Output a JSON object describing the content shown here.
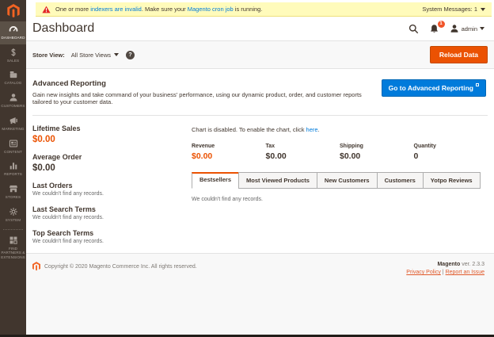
{
  "message_bar": {
    "prefix": "One or more ",
    "indexers_link": "indexers are invalid",
    "middle": ". Make sure your ",
    "cron_link": "Magento cron job",
    "suffix": " is running.",
    "system_messages_label": "System Messages: 1"
  },
  "header": {
    "title": "Dashboard",
    "notification_count": "1",
    "user_name": "admin"
  },
  "toolbar": {
    "store_view_label": "Store View:",
    "store_view_value": "All Store Views",
    "help_glyph": "?",
    "reload_button": "Reload Data"
  },
  "sidebar": {
    "items": [
      {
        "label": "DASHBOARD",
        "icon": "speedometer-icon",
        "active": true
      },
      {
        "label": "SALES",
        "icon": "dollar-icon"
      },
      {
        "label": "CATALOG",
        "icon": "box-icon"
      },
      {
        "label": "CUSTOMERS",
        "icon": "person-icon"
      },
      {
        "label": "MARKETING",
        "icon": "megaphone-icon"
      },
      {
        "label": "CONTENT",
        "icon": "page-icon"
      },
      {
        "label": "REPORTS",
        "icon": "bar-chart-icon"
      },
      {
        "label": "STORES",
        "icon": "storefront-icon"
      },
      {
        "label": "SYSTEM",
        "icon": "gear-icon"
      },
      {
        "label": "FIND PARTNERS & EXTENSIONS",
        "icon": "extensions-icon"
      }
    ]
  },
  "advanced_reporting": {
    "title": "Advanced Reporting",
    "description": "Gain new insights and take command of your business' performance, using our dynamic product, order, and customer reports tailored to your customer data.",
    "button": "Go to Advanced Reporting"
  },
  "metrics": [
    {
      "label": "Lifetime Sales",
      "value": "$0.00"
    },
    {
      "label": "Average Order",
      "value": "$0.00"
    },
    {
      "label": "Last Orders",
      "note": "We couldn't find any records."
    },
    {
      "label": "Last Search Terms",
      "note": "We couldn't find any records."
    },
    {
      "label": "Top Search Terms",
      "note": "We couldn't find any records."
    }
  ],
  "chart": {
    "disabled_prefix": "Chart is disabled. To enable the chart, click ",
    "enable_link": "here",
    "suffix": "."
  },
  "stats": [
    {
      "label": "Revenue",
      "value": "$0.00"
    },
    {
      "label": "Tax",
      "value": "$0.00"
    },
    {
      "label": "Shipping",
      "value": "$0.00"
    },
    {
      "label": "Quantity",
      "value": "0"
    }
  ],
  "tabs": {
    "items": [
      {
        "label": "Bestsellers",
        "active": true
      },
      {
        "label": "Most Viewed Products"
      },
      {
        "label": "New Customers"
      },
      {
        "label": "Customers"
      },
      {
        "label": "Yotpo Reviews"
      }
    ],
    "empty_note": "We couldn't find any records."
  },
  "footer": {
    "copyright": "Copyright © 2020 Magento Commerce Inc. All rights reserved.",
    "brand": "Magento",
    "version": " ver. 2.3.3",
    "privacy_link": "Privacy Policy",
    "separator": " | ",
    "report_link": "Report an Issue"
  },
  "colors": {
    "accent_orange": "#eb5202",
    "link_blue": "#007bdb",
    "warning_bg": "#fffbbb",
    "sidebar_bg": "#41362e"
  }
}
